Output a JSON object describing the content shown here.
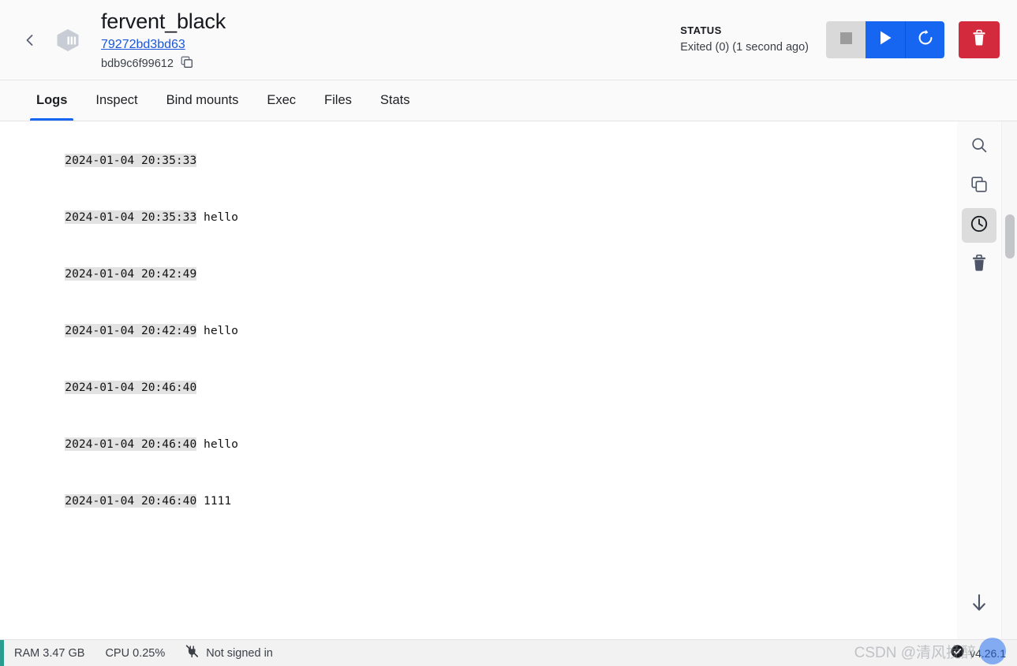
{
  "header": {
    "back_icon": "chevron-left-icon",
    "container_icon": "container-box-icon",
    "container_name": "fervent_black",
    "image_link": "79272bd3bd63",
    "container_id": "bdb9c6f99612",
    "copy_icon": "copy-icon",
    "status_label": "STATUS",
    "status_value": "Exited (0) (1 second ago)",
    "actions": {
      "stop": {
        "name": "stop-button",
        "icon": "stop-square-icon",
        "color": "#d9d9d9",
        "enabled": false
      },
      "start": {
        "name": "start-button",
        "icon": "play-triangle-icon",
        "color": "#1766f2",
        "enabled": true
      },
      "restart": {
        "name": "restart-button",
        "icon": "restart-circular-arrow-icon",
        "color": "#1766f2",
        "enabled": true
      },
      "delete": {
        "name": "delete-button",
        "icon": "trash-icon",
        "color": "#d42a3e",
        "enabled": true
      }
    }
  },
  "tabs": [
    {
      "label": "Logs",
      "active": true
    },
    {
      "label": "Inspect",
      "active": false
    },
    {
      "label": "Bind mounts",
      "active": false
    },
    {
      "label": "Exec",
      "active": false
    },
    {
      "label": "Files",
      "active": false
    },
    {
      "label": "Stats",
      "active": false
    }
  ],
  "logs": {
    "lines": [
      {
        "timestamp": "2024-01-04 20:35:33",
        "message": ""
      },
      {
        "timestamp": "2024-01-04 20:35:33",
        "message": "hello"
      },
      {
        "timestamp": "2024-01-04 20:42:49",
        "message": ""
      },
      {
        "timestamp": "2024-01-04 20:42:49",
        "message": "hello"
      },
      {
        "timestamp": "2024-01-04 20:46:40",
        "message": ""
      },
      {
        "timestamp": "2024-01-04 20:46:40",
        "message": "hello"
      },
      {
        "timestamp": "2024-01-04 20:46:40",
        "message": "1111"
      }
    ],
    "toolbar": [
      {
        "name": "search-logs-button",
        "icon": "search-icon",
        "active": false
      },
      {
        "name": "copy-logs-button",
        "icon": "copy-icon",
        "active": false
      },
      {
        "name": "toggle-timestamps-button",
        "icon": "clock-icon",
        "active": true
      },
      {
        "name": "clear-logs-button",
        "icon": "trash-icon",
        "active": false
      }
    ],
    "scroll_bottom_icon": "arrow-down-icon"
  },
  "statusbar": {
    "ram": "RAM 3.47 GB",
    "cpu": "CPU 0.25%",
    "signin_icon": "plug-disconnected-icon",
    "signin_text": "Not signed in",
    "version_icon": "check-circle-icon",
    "version": "v4.26.1",
    "engine_color": "#2a9d8f"
  },
  "watermark": {
    "text": "CSDN @清风挽醉"
  }
}
